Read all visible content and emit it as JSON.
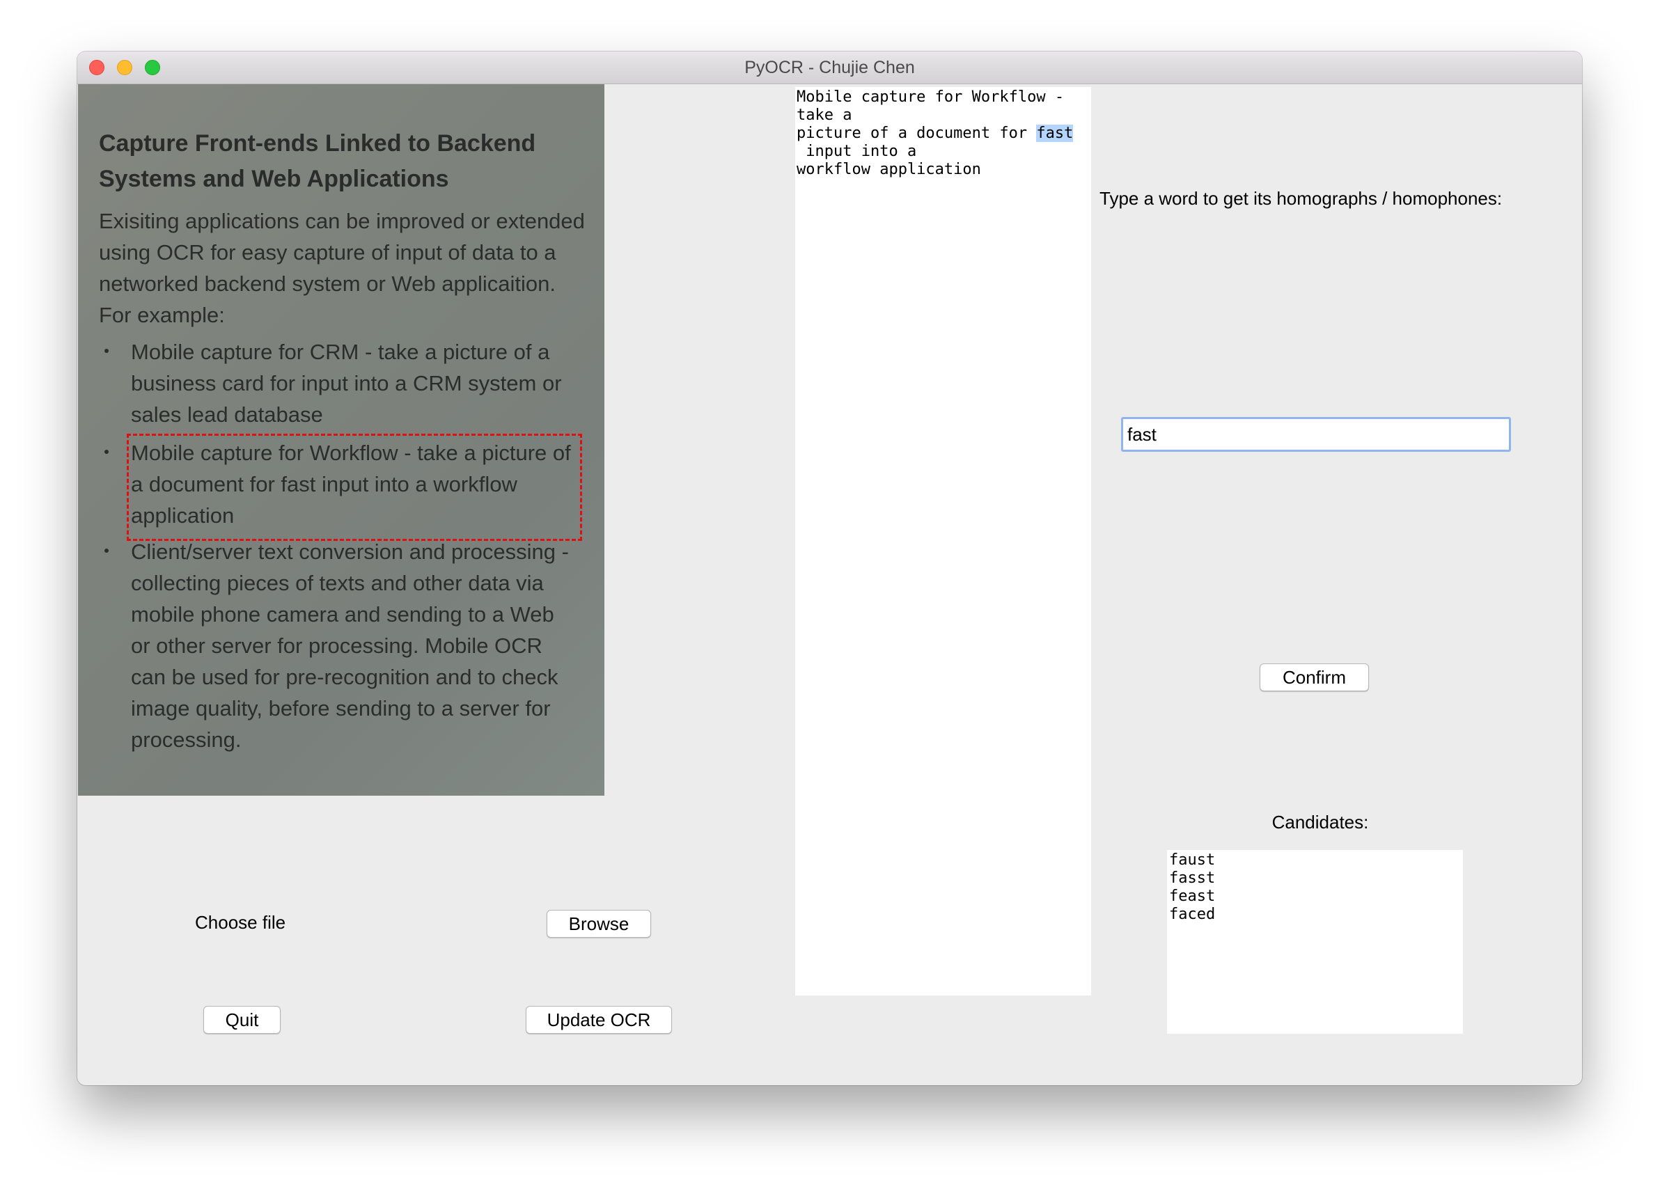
{
  "window": {
    "title": "PyOCR - Chujie Chen"
  },
  "scan": {
    "heading": "Capture Front-ends Linked to Backend Systems and Web Applications",
    "intro": "Exisiting applications can be improved or extended using OCR for easy capture of input of data to a networked backend system or Web applicaition. For example:",
    "bullets": [
      "Mobile capture  for CRM - take a picture of a business card for input into a CRM system or sales lead database",
      "Mobile capture  for Workflow - take a picture of a document for fast input into a workflow  application",
      "Client/server text conversion and processing - collecting pieces of texts and other data via mobile  phone camera and sending to a Web or other server for processing. Mobile  OCR can be used for pre-recognition and to check image quality, before sending to a server  for processing."
    ],
    "highlight_color": "#e01010"
  },
  "ocr": {
    "line1": "Mobile capture for Workflow -",
    "line2": "take a",
    "line3_prefix": "picture of a document for ",
    "highlighted_word": "fast",
    "line4": " input into a",
    "line5": "workflow application"
  },
  "lookup": {
    "prompt": "Type a word to get its homographs / homophones:",
    "input_value": "fast",
    "confirm_label": "Confirm",
    "candidates_label": "Candidates:",
    "candidates": [
      "faust",
      "fasst",
      "feast",
      "faced"
    ]
  },
  "controls": {
    "choose_file_label": "Choose file",
    "browse_label": "Browse",
    "quit_label": "Quit",
    "update_ocr_label": "Update OCR"
  }
}
